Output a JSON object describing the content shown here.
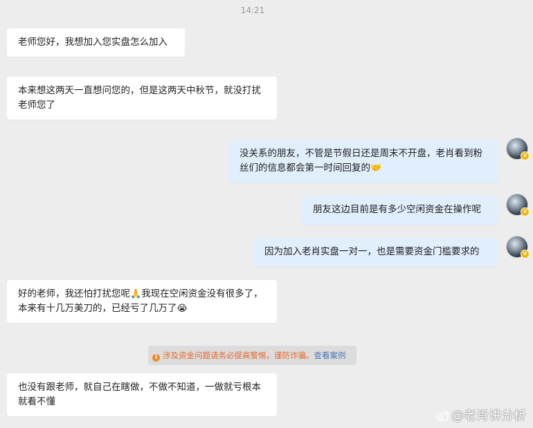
{
  "timestamp": "14:21",
  "messages": [
    {
      "side": "left",
      "text": "老师您好，我想加入您实盘怎么加入",
      "emoji": ""
    },
    {
      "side": "left",
      "text": "本来想这两天一直想问您的，但是这两天中秋节，就没打扰老师您了",
      "emoji": ""
    },
    {
      "side": "right",
      "text": "没关系的朋友，不管是节假日还是周末不开盘，老肖看到粉丝们的信息都会第一时间回复的",
      "emoji": "🤝"
    },
    {
      "side": "right",
      "text": "朋友这边目前是有多少空闲资金在操作呢",
      "emoji": ""
    },
    {
      "side": "right",
      "text": "因为加入老肖实盘一对一，也是需要资金门槛要求的",
      "emoji": ""
    },
    {
      "side": "left",
      "text_a": "好的老师，我还怕打扰您呢",
      "emoji_a": "🙏",
      "text_b": "我现在空闲资金没有很多了，本来有十几万美刀的，已经亏了几万了",
      "emoji_b": "😭"
    },
    {
      "side": "left",
      "text": "也没有跟老师，就自己在瞎做，不做不知道，一做就亏根本就看不懂",
      "emoji": ""
    }
  ],
  "notice": {
    "text": "涉及资金问题请务必提高警惕，谨防诈骗。",
    "link": "查看案例",
    "color": "#e8672c"
  },
  "watermark": "@老肖讲分析",
  "colors": {
    "background": "#ededed",
    "left_bubble": "#ffffff",
    "right_bubble": "#e1eefc"
  }
}
